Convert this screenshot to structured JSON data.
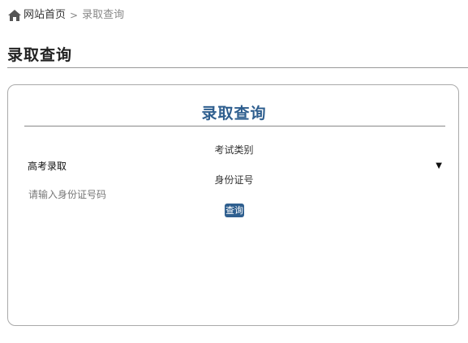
{
  "breadcrumb": {
    "home_icon": "home-icon",
    "home_label": "网站首页",
    "separator": ">",
    "current": "录取查询"
  },
  "page": {
    "title": "录取查询"
  },
  "form": {
    "title": "录取查询",
    "exam_type_label": "考试类别",
    "exam_type_value": "高考录取",
    "id_label": "身份证号",
    "id_placeholder": "请输入身份证号码",
    "submit_label": "查询"
  },
  "colors": {
    "accent": "#2f5f8f",
    "border": "#aaaaaa"
  }
}
